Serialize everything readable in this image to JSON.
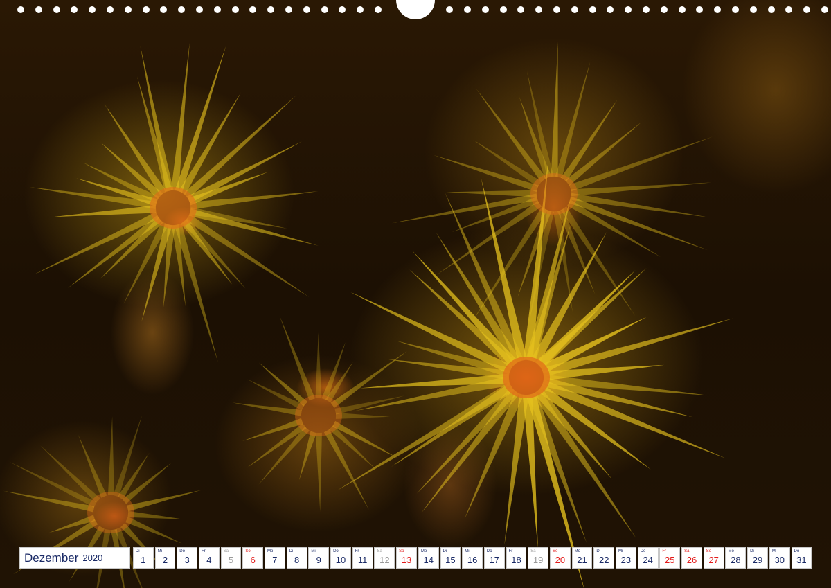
{
  "calendar": {
    "month": "Dezember",
    "year": "2020",
    "days": [
      {
        "wd": "Di",
        "num": "1",
        "type": "week"
      },
      {
        "wd": "Mi",
        "num": "2",
        "type": "week"
      },
      {
        "wd": "Do",
        "num": "3",
        "type": "week"
      },
      {
        "wd": "Fr",
        "num": "4",
        "type": "week"
      },
      {
        "wd": "Sa",
        "num": "5",
        "type": "sat"
      },
      {
        "wd": "So",
        "num": "6",
        "type": "sun"
      },
      {
        "wd": "Mo",
        "num": "7",
        "type": "week"
      },
      {
        "wd": "Di",
        "num": "8",
        "type": "week"
      },
      {
        "wd": "Mi",
        "num": "9",
        "type": "week"
      },
      {
        "wd": "Do",
        "num": "10",
        "type": "week"
      },
      {
        "wd": "Fr",
        "num": "11",
        "type": "week"
      },
      {
        "wd": "Sa",
        "num": "12",
        "type": "sat"
      },
      {
        "wd": "So",
        "num": "13",
        "type": "sun"
      },
      {
        "wd": "Mo",
        "num": "14",
        "type": "week"
      },
      {
        "wd": "Di",
        "num": "15",
        "type": "week"
      },
      {
        "wd": "Mi",
        "num": "16",
        "type": "week"
      },
      {
        "wd": "Do",
        "num": "17",
        "type": "week"
      },
      {
        "wd": "Fr",
        "num": "18",
        "type": "week"
      },
      {
        "wd": "Sa",
        "num": "19",
        "type": "sat"
      },
      {
        "wd": "So",
        "num": "20",
        "type": "sun"
      },
      {
        "wd": "Mo",
        "num": "21",
        "type": "week"
      },
      {
        "wd": "Di",
        "num": "22",
        "type": "week"
      },
      {
        "wd": "Mi",
        "num": "23",
        "type": "week"
      },
      {
        "wd": "Do",
        "num": "24",
        "type": "week"
      },
      {
        "wd": "Fr",
        "num": "25",
        "type": "hol"
      },
      {
        "wd": "Sa",
        "num": "26",
        "type": "hol"
      },
      {
        "wd": "So",
        "num": "27",
        "type": "sun"
      },
      {
        "wd": "Mo",
        "num": "28",
        "type": "week"
      },
      {
        "wd": "Di",
        "num": "29",
        "type": "week"
      },
      {
        "wd": "Mi",
        "num": "30",
        "type": "week"
      },
      {
        "wd": "Do",
        "num": "31",
        "type": "week"
      }
    ]
  },
  "colors": {
    "text": "#1a2a66",
    "sunday": "#e21a1a",
    "saturday": "#9a9a9a",
    "polyp_yellow": "#e6c21e",
    "polyp_orange": "#e06a18"
  },
  "binding": {
    "hole_count": 46
  }
}
